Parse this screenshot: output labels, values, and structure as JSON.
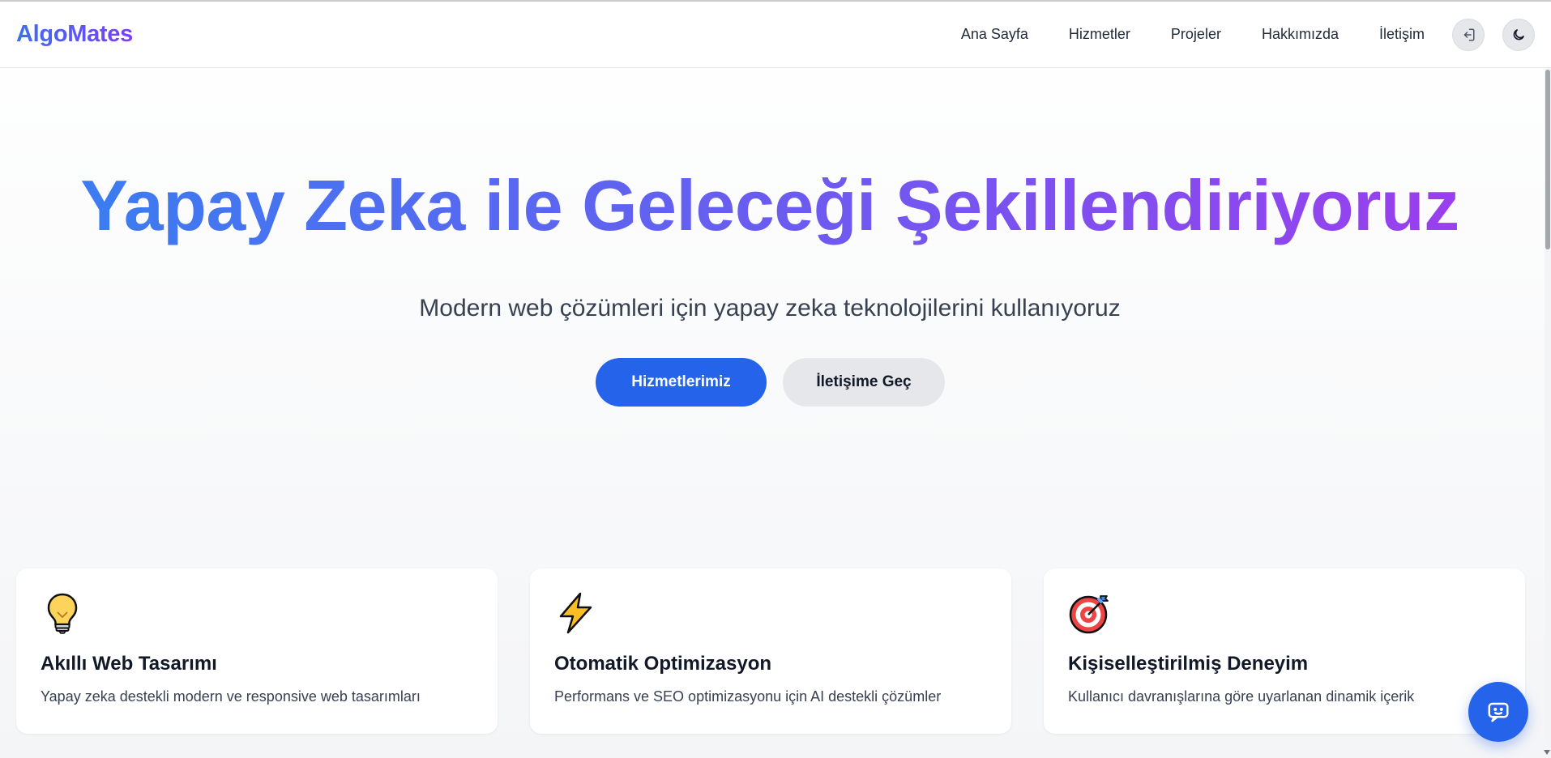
{
  "brand": {
    "name": "AlgoMates"
  },
  "nav": {
    "items": [
      {
        "label": "Ana Sayfa"
      },
      {
        "label": "Hizmetler"
      },
      {
        "label": "Projeler"
      },
      {
        "label": "Hakkımızda"
      },
      {
        "label": "İletişim"
      }
    ],
    "login_icon": "login-icon",
    "theme_icon": "moon-icon"
  },
  "hero": {
    "title": "Yapay Zeka ile Geleceği Şekillendiriyoruz",
    "subtitle": "Modern web çözümleri için yapay zeka teknolojilerini kullanıyoruz",
    "primary_button": "Hizmetlerimiz",
    "secondary_button": "İletişime Geç"
  },
  "features": [
    {
      "icon": "lightbulb-icon",
      "title": "Akıllı Web Tasarımı",
      "description": "Yapay zeka destekli modern ve responsive web tasarımları"
    },
    {
      "icon": "lightning-icon",
      "title": "Otomatik Optimizasyon",
      "description": "Performans ve SEO optimizasyonu için AI destekli çözümler"
    },
    {
      "icon": "target-icon",
      "title": "Kişiselleştirilmiş Deneyim",
      "description": "Kullanıcı davranışlarına göre uyarlanan dinamik içerik"
    }
  ],
  "chat": {
    "icon": "chat-bot-icon"
  },
  "colors": {
    "primary": "#2563eb",
    "gradient_start": "#3b7cf0",
    "gradient_end": "#9a3fee",
    "secondary_button": "#e5e7eb"
  }
}
